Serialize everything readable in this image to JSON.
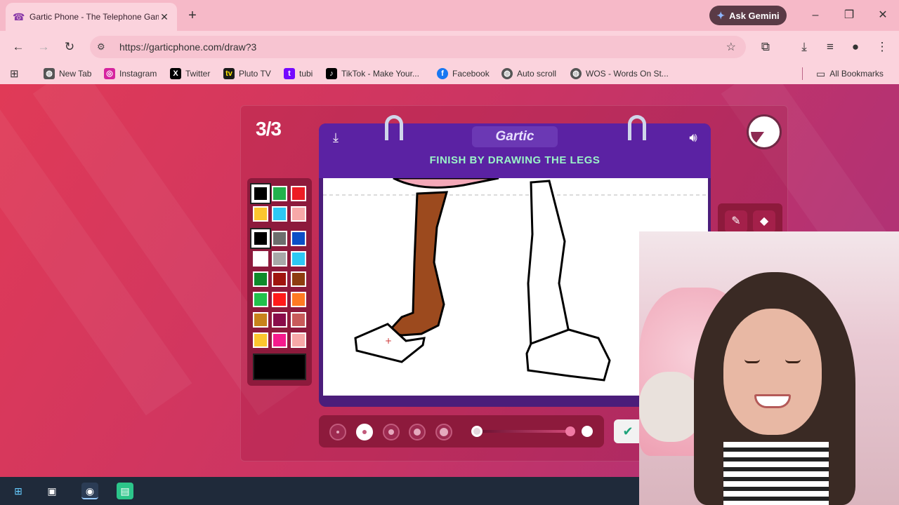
{
  "browser": {
    "tab_title": "Gartic Phone - The Telephone Game",
    "tab_close": "✕",
    "new_tab": "+",
    "gemini_label": "Ask Gemini",
    "url": "https://garticphone.com/draw?3",
    "window_controls": [
      "–",
      "❐",
      "✕"
    ]
  },
  "bookmarks": {
    "items": [
      {
        "label": "New Tab",
        "icon": "globe-icon"
      },
      {
        "label": "Instagram",
        "icon": "instagram-icon"
      },
      {
        "label": "Twitter",
        "icon": "x-icon"
      },
      {
        "label": "Pluto TV",
        "icon": "pluto-tv-icon"
      },
      {
        "label": "tubi",
        "icon": "tubi-icon"
      },
      {
        "label": "TikTok - Make Your...",
        "icon": "tiktok-icon"
      },
      {
        "label": "Facebook",
        "icon": "facebook-icon"
      },
      {
        "label": "Auto scroll",
        "icon": "globe-icon"
      },
      {
        "label": "WOS - Words On St...",
        "icon": "globe-icon"
      }
    ],
    "all_bookmarks": "All Bookmarks"
  },
  "game": {
    "round": "3/3",
    "logo": "Gartic",
    "instruction": "FINISH BY DRAWING THE LEGS",
    "palette_colors": [
      "#000000",
      "#22b14c",
      "#ed1c24",
      "#fcc62f",
      "#2dc8f4",
      "#f7a8a8",
      "#000000",
      "#6d6d6d",
      "#0b4fc7",
      "#ffffff",
      "#a8a8a8",
      "#2dc8f4",
      "#0e8a2a",
      "#a0140e",
      "#8e3d10",
      "#22c14c",
      "#ff1a1a",
      "#ff7a22",
      "#c8821c",
      "#8a0d4a",
      "#c85a5a",
      "#fcc62f",
      "#f51a8c",
      "#f7a8a8"
    ],
    "selected_color": "#000000",
    "brush_sizes": [
      1,
      2,
      3,
      4,
      5
    ],
    "selected_brush": 2,
    "accent": "#5b22a3",
    "instruction_color": "#9af3c8"
  }
}
